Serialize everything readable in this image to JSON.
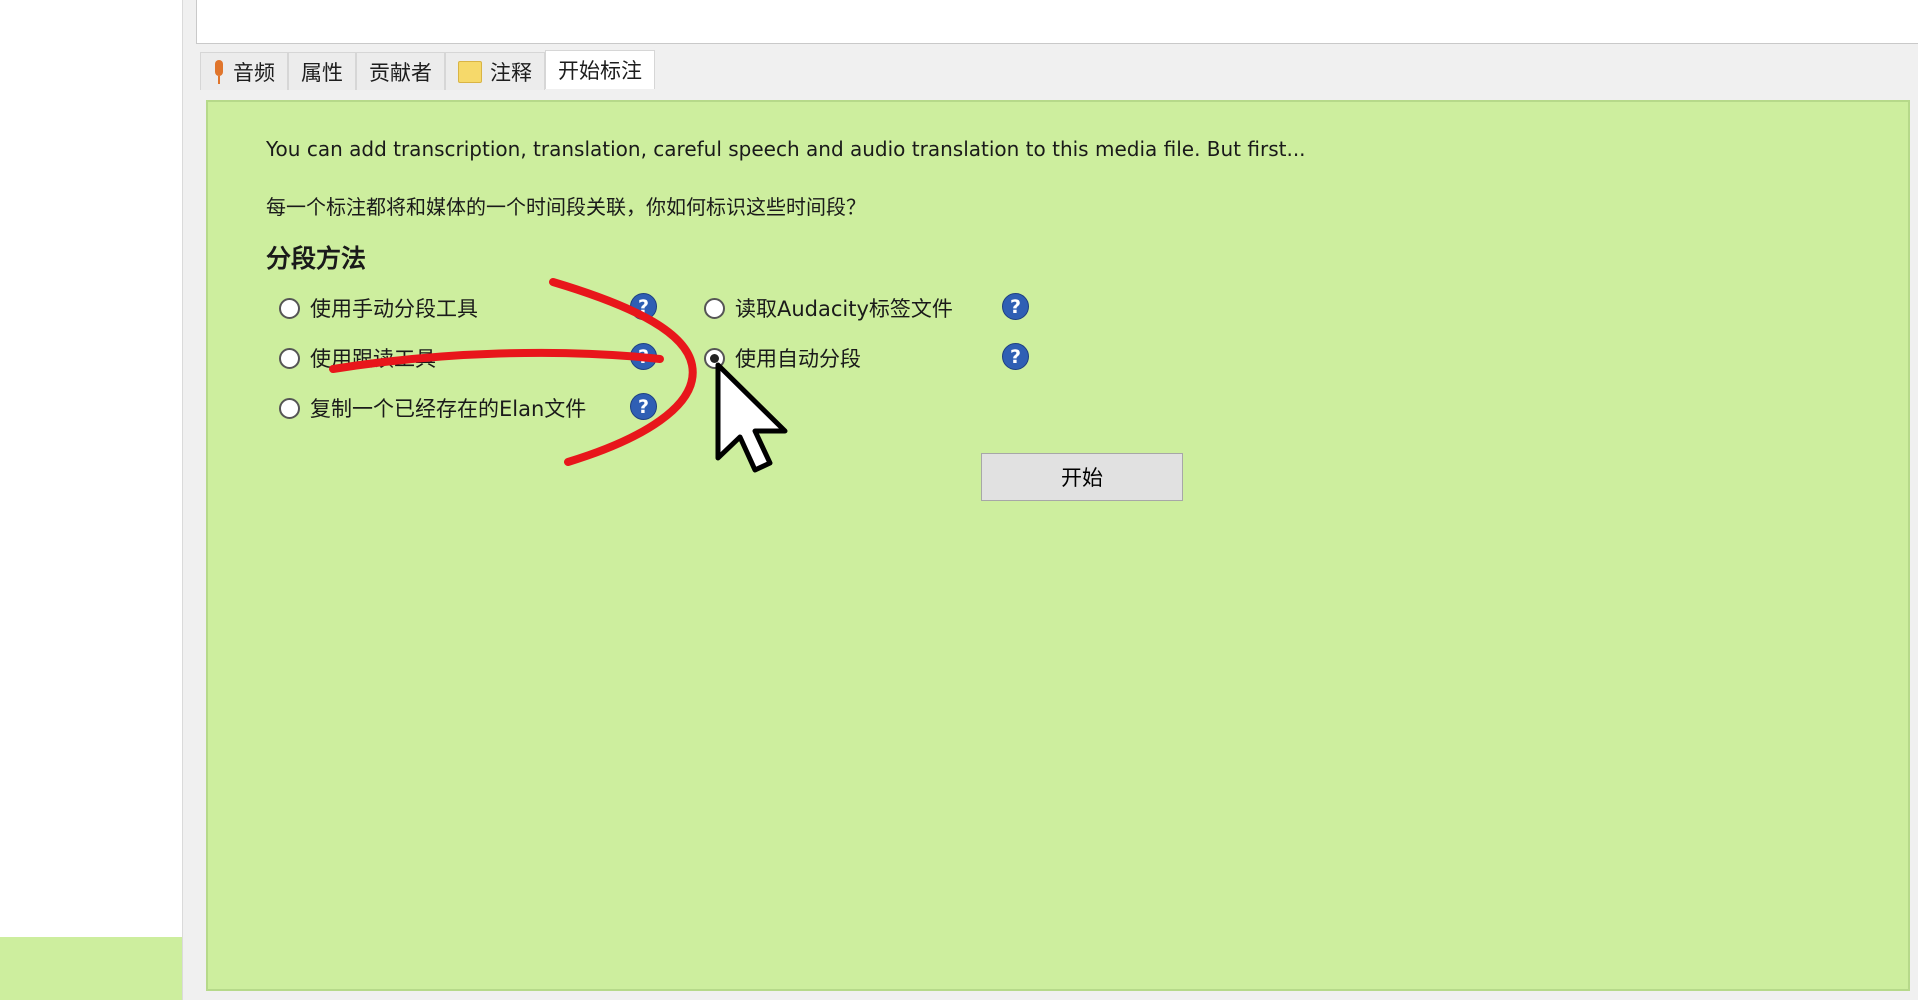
{
  "tabs": [
    {
      "label": "音频",
      "icon": "microphone-icon"
    },
    {
      "label": "属性"
    },
    {
      "label": "贡献者"
    },
    {
      "label": "注释",
      "icon": "note-icon"
    },
    {
      "label": "开始标注",
      "active": true
    }
  ],
  "panel": {
    "intro": "You can add transcription, translation, careful speech and audio translation to this media file. But first...",
    "question": "每一个标注都将和媒体的一个时间段关联，你如何标识这些时间段？",
    "section_title": "分段方法",
    "options": [
      {
        "label": "使用手动分段工具",
        "checked": false
      },
      {
        "label": "读取Audacity标签文件",
        "checked": false
      },
      {
        "label": "使用跟读工具",
        "checked": false
      },
      {
        "label": "使用自动分段",
        "checked": true
      },
      {
        "label": "复制一个已经存在的Elan文件",
        "checked": false
      }
    ],
    "help_symbol": "?",
    "start_button": "开始"
  },
  "colors": {
    "panel_background": "#cdee9e",
    "annotation_stroke": "#e8161b",
    "help_icon": "#2f5fb4"
  }
}
